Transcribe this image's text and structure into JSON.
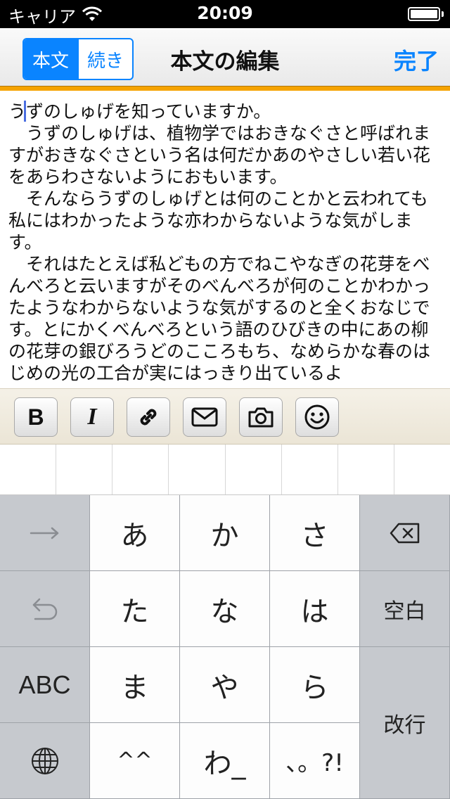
{
  "status_bar": {
    "carrier": "キャリア",
    "time": "20:09"
  },
  "nav": {
    "segments": [
      "本文",
      "続き"
    ],
    "selected_segment": "本文",
    "title": "本文の編集",
    "done_label": "完了"
  },
  "editor": {
    "text": "うずのしゅげを知っていますか。\n　うずのしゅげは、植物学ではおきなぐさと呼ばれますがおきなぐさという名は何だかあのやさしい若い花をあらわさないようにおもいます。\n　そんならうずのしゅげとは何のことかと云われても私にはわかったような亦わからないような気がします。\n　それはたとえば私どもの方でねこやなぎの花芽をべんべろと云いますがそのべんべろが何のことかわかったようなわからないような気がするのと全くおなじです。とにかくべんべろという語のひびきの中にあの柳の花芽の銀びろうどのこころもち、なめらかな春のはじめの光の工合が実にはっきり出ているよ"
  },
  "toolbar": {
    "buttons": [
      {
        "name": "bold",
        "label": "B"
      },
      {
        "name": "italic",
        "label": "I"
      },
      {
        "name": "link",
        "icon": "link-icon"
      },
      {
        "name": "mail",
        "icon": "mail-icon"
      },
      {
        "name": "camera",
        "icon": "camera-icon"
      },
      {
        "name": "emoji",
        "icon": "smiley-icon"
      }
    ]
  },
  "keyboard": {
    "rows": [
      [
        "あ",
        "か",
        "さ"
      ],
      [
        "た",
        "な",
        "は"
      ],
      [
        "ま",
        "や",
        "ら"
      ],
      [
        "^^",
        "わ_",
        "、。?!"
      ]
    ],
    "space_label": "空白",
    "return_label": "改行",
    "abc_label": "ABC",
    "icons": {
      "next": "arrow-right-icon",
      "undo": "undo-icon",
      "globe": "globe-icon",
      "delete": "delete-icon"
    }
  },
  "colors": {
    "accent_blue": "#0a84ff",
    "toolbar_accent": "#f5a300"
  }
}
